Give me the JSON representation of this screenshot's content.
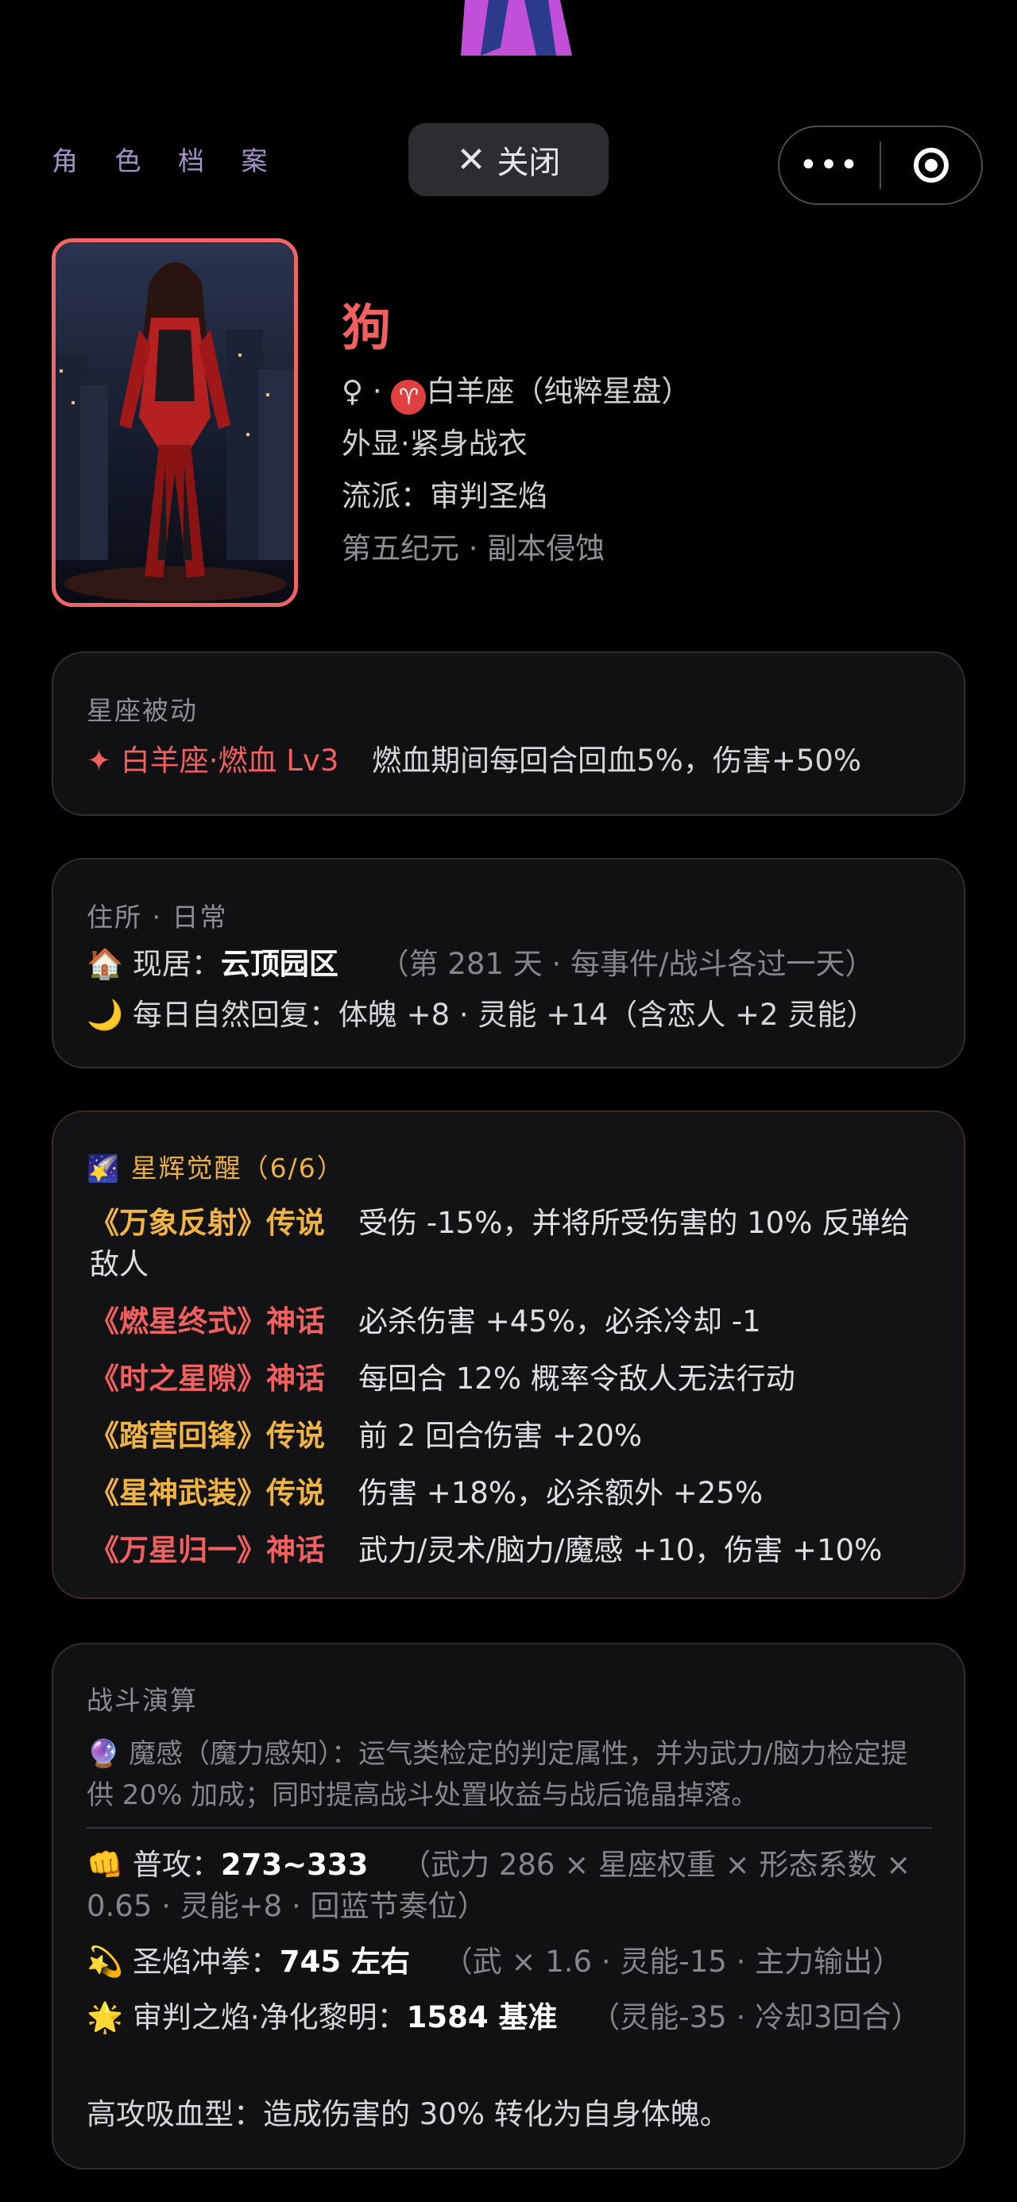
{
  "header": {
    "title": "角 色 档 案",
    "close_label": "关闭",
    "menu_dots": "•••"
  },
  "profile": {
    "name": "狗",
    "gender_symbol": "♀",
    "zodiac_symbol": "♈",
    "zodiac": "白羊座（纯粹星盘）",
    "appearance": "外显·紧身战衣",
    "school": "流派：审判圣焰",
    "era": "第五纪元 · 副本侵蚀"
  },
  "passive": {
    "title": "星座被动",
    "name": "白羊座·燃血 Lv3",
    "desc": "燃血期间每回合回血5%，伤害+50%"
  },
  "residence": {
    "title": "住所 · 日常",
    "home_icon": "🏠",
    "home_label": "现居：",
    "home_value": "云顶园区",
    "home_note": "（第 281 天 · 每事件/战斗各过一天）",
    "moon_icon": "🌙",
    "recovery": "每日自然回复：体魄 +8 · 灵能 +14（含恋人 +2 灵能）"
  },
  "awakening": {
    "icon": "🌠",
    "title": "星辉觉醒（6/6）",
    "items": [
      {
        "tag": "《万象反射》传说",
        "desc": "受伤 -15%，并将所受伤害的 10% 反弹给敌人",
        "color": "#f0b445"
      },
      {
        "tag": "《燃星终式》神话",
        "desc": "必杀伤害 +45%，必杀冷却 -1",
        "color": "#f06060"
      },
      {
        "tag": "《时之星隙》神话",
        "desc": "每回合 12% 概率令敌人无法行动",
        "color": "#f06060"
      },
      {
        "tag": "《踏营回锋》传说",
        "desc": "前 2 回合伤害 +20%",
        "color": "#f0b445"
      },
      {
        "tag": "《星神武装》传说",
        "desc": "伤害 +18%，必杀额外 +25%",
        "color": "#f0b445"
      },
      {
        "tag": "《万星归一》神话",
        "desc": "武力/灵术/脑力/魔感 +10，伤害 +10%",
        "color": "#f06060"
      }
    ]
  },
  "battle": {
    "title": "战斗演算",
    "magic_icon": "🔮",
    "magic_desc": "魔感（魔力感知）：运气类检定的判定属性，并为武力/脑力检定提供 20% 加成；同时提高战斗处置收益与战后诡晶掉落。",
    "attacks": [
      {
        "icon": "👊",
        "label": "普攻：",
        "value": "273~333",
        "note": "（武力 286 × 星座权重 × 形态系数 × 0.65 · 灵能+8 · 回蓝节奏位）"
      },
      {
        "icon": "💫",
        "label": "圣焰冲拳：",
        "value": "745 左右",
        "note": "（武 × 1.6 · 灵能-15 · 主力输出）"
      },
      {
        "icon": "🌟",
        "label": "审判之焰·净化黎明：",
        "value": "1584 基准",
        "note": "（灵能-35 · 冷却3回合）"
      }
    ],
    "footer": "高攻吸血型：造成伤害的 30% 转化为自身体魄。"
  }
}
